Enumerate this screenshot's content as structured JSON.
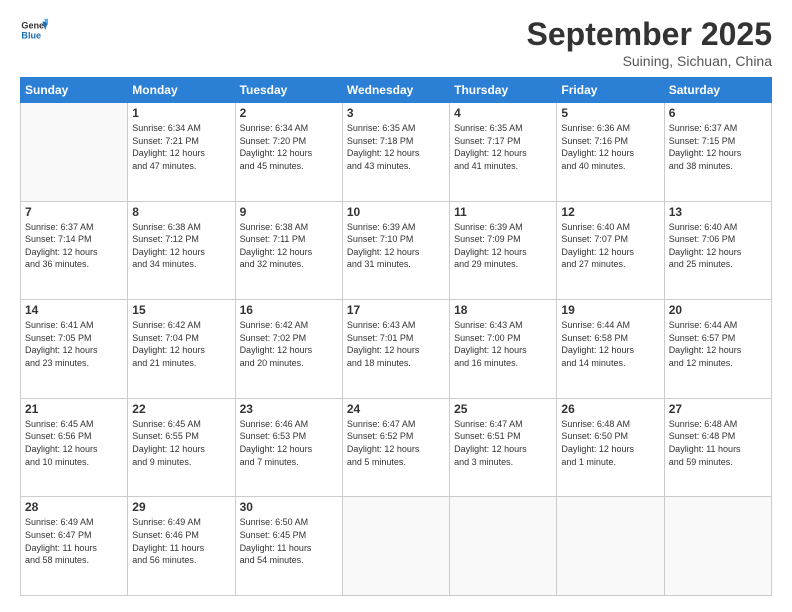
{
  "logo": {
    "line1": "General",
    "line2": "Blue"
  },
  "title": "September 2025",
  "subtitle": "Suining, Sichuan, China",
  "days_header": [
    "Sunday",
    "Monday",
    "Tuesday",
    "Wednesday",
    "Thursday",
    "Friday",
    "Saturday"
  ],
  "weeks": [
    [
      {
        "day": "",
        "info": ""
      },
      {
        "day": "1",
        "info": "Sunrise: 6:34 AM\nSunset: 7:21 PM\nDaylight: 12 hours\nand 47 minutes."
      },
      {
        "day": "2",
        "info": "Sunrise: 6:34 AM\nSunset: 7:20 PM\nDaylight: 12 hours\nand 45 minutes."
      },
      {
        "day": "3",
        "info": "Sunrise: 6:35 AM\nSunset: 7:18 PM\nDaylight: 12 hours\nand 43 minutes."
      },
      {
        "day": "4",
        "info": "Sunrise: 6:35 AM\nSunset: 7:17 PM\nDaylight: 12 hours\nand 41 minutes."
      },
      {
        "day": "5",
        "info": "Sunrise: 6:36 AM\nSunset: 7:16 PM\nDaylight: 12 hours\nand 40 minutes."
      },
      {
        "day": "6",
        "info": "Sunrise: 6:37 AM\nSunset: 7:15 PM\nDaylight: 12 hours\nand 38 minutes."
      }
    ],
    [
      {
        "day": "7",
        "info": "Sunrise: 6:37 AM\nSunset: 7:14 PM\nDaylight: 12 hours\nand 36 minutes."
      },
      {
        "day": "8",
        "info": "Sunrise: 6:38 AM\nSunset: 7:12 PM\nDaylight: 12 hours\nand 34 minutes."
      },
      {
        "day": "9",
        "info": "Sunrise: 6:38 AM\nSunset: 7:11 PM\nDaylight: 12 hours\nand 32 minutes."
      },
      {
        "day": "10",
        "info": "Sunrise: 6:39 AM\nSunset: 7:10 PM\nDaylight: 12 hours\nand 31 minutes."
      },
      {
        "day": "11",
        "info": "Sunrise: 6:39 AM\nSunset: 7:09 PM\nDaylight: 12 hours\nand 29 minutes."
      },
      {
        "day": "12",
        "info": "Sunrise: 6:40 AM\nSunset: 7:07 PM\nDaylight: 12 hours\nand 27 minutes."
      },
      {
        "day": "13",
        "info": "Sunrise: 6:40 AM\nSunset: 7:06 PM\nDaylight: 12 hours\nand 25 minutes."
      }
    ],
    [
      {
        "day": "14",
        "info": "Sunrise: 6:41 AM\nSunset: 7:05 PM\nDaylight: 12 hours\nand 23 minutes."
      },
      {
        "day": "15",
        "info": "Sunrise: 6:42 AM\nSunset: 7:04 PM\nDaylight: 12 hours\nand 21 minutes."
      },
      {
        "day": "16",
        "info": "Sunrise: 6:42 AM\nSunset: 7:02 PM\nDaylight: 12 hours\nand 20 minutes."
      },
      {
        "day": "17",
        "info": "Sunrise: 6:43 AM\nSunset: 7:01 PM\nDaylight: 12 hours\nand 18 minutes."
      },
      {
        "day": "18",
        "info": "Sunrise: 6:43 AM\nSunset: 7:00 PM\nDaylight: 12 hours\nand 16 minutes."
      },
      {
        "day": "19",
        "info": "Sunrise: 6:44 AM\nSunset: 6:58 PM\nDaylight: 12 hours\nand 14 minutes."
      },
      {
        "day": "20",
        "info": "Sunrise: 6:44 AM\nSunset: 6:57 PM\nDaylight: 12 hours\nand 12 minutes."
      }
    ],
    [
      {
        "day": "21",
        "info": "Sunrise: 6:45 AM\nSunset: 6:56 PM\nDaylight: 12 hours\nand 10 minutes."
      },
      {
        "day": "22",
        "info": "Sunrise: 6:45 AM\nSunset: 6:55 PM\nDaylight: 12 hours\nand 9 minutes."
      },
      {
        "day": "23",
        "info": "Sunrise: 6:46 AM\nSunset: 6:53 PM\nDaylight: 12 hours\nand 7 minutes."
      },
      {
        "day": "24",
        "info": "Sunrise: 6:47 AM\nSunset: 6:52 PM\nDaylight: 12 hours\nand 5 minutes."
      },
      {
        "day": "25",
        "info": "Sunrise: 6:47 AM\nSunset: 6:51 PM\nDaylight: 12 hours\nand 3 minutes."
      },
      {
        "day": "26",
        "info": "Sunrise: 6:48 AM\nSunset: 6:50 PM\nDaylight: 12 hours\nand 1 minute."
      },
      {
        "day": "27",
        "info": "Sunrise: 6:48 AM\nSunset: 6:48 PM\nDaylight: 11 hours\nand 59 minutes."
      }
    ],
    [
      {
        "day": "28",
        "info": "Sunrise: 6:49 AM\nSunset: 6:47 PM\nDaylight: 11 hours\nand 58 minutes."
      },
      {
        "day": "29",
        "info": "Sunrise: 6:49 AM\nSunset: 6:46 PM\nDaylight: 11 hours\nand 56 minutes."
      },
      {
        "day": "30",
        "info": "Sunrise: 6:50 AM\nSunset: 6:45 PM\nDaylight: 11 hours\nand 54 minutes."
      },
      {
        "day": "",
        "info": ""
      },
      {
        "day": "",
        "info": ""
      },
      {
        "day": "",
        "info": ""
      },
      {
        "day": "",
        "info": ""
      }
    ]
  ]
}
